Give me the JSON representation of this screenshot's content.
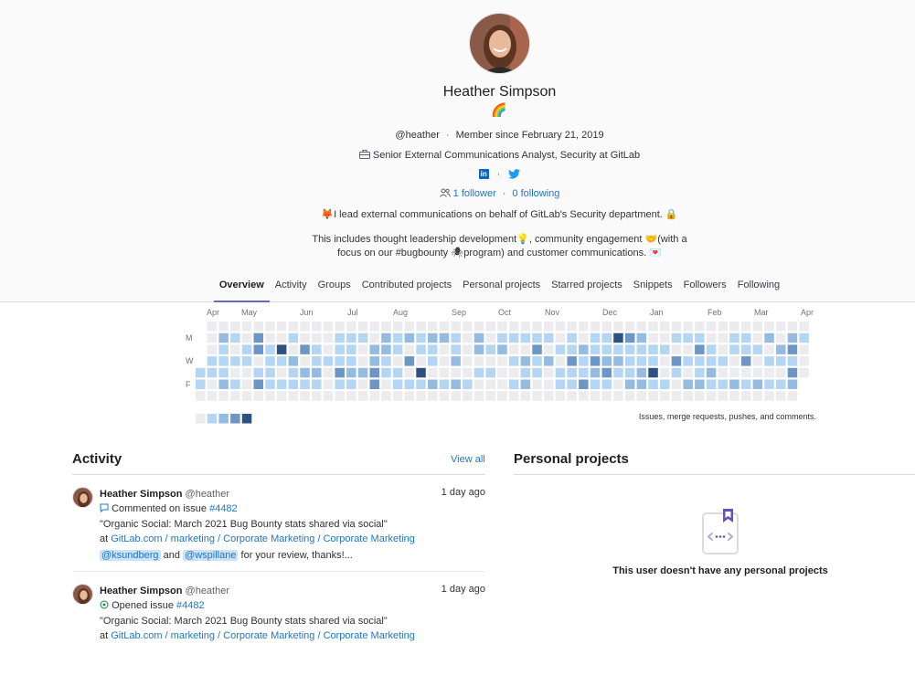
{
  "profile": {
    "name": "Heather Simpson",
    "status_emoji": "🌈",
    "username": "@heather",
    "member_since": "Member since February 21, 2019",
    "job_title": "Senior External Communications Analyst, Security at GitLab",
    "followers": "1 follower",
    "following": "0 following",
    "bio_line1_emoji": "🦊",
    "bio_line1": "I lead external communications on behalf of GitLab's Security department.",
    "bio_line1_end_emoji": "🔒",
    "bio_line2_a": "This includes thought leadership development",
    "bio_line2_emoji_a": "💡",
    "bio_line2_b": ", community engagement",
    "bio_line2_emoji_b": "🤝",
    "bio_line2_c": "(with a",
    "bio_line3_a": "focus on our #bugbounty",
    "bio_line3_emoji": "🕷",
    "bio_line3_b": "program) and customer communications.",
    "bio_line3_end_emoji": "💌"
  },
  "tabs": [
    "Overview",
    "Activity",
    "Groups",
    "Contributed projects",
    "Personal projects",
    "Starred projects",
    "Snippets",
    "Followers",
    "Following"
  ],
  "calendar": {
    "months": [
      "Apr",
      "May",
      "Jun",
      "Jul",
      "Aug",
      "Sep",
      "Oct",
      "Nov",
      "Dec",
      "Jan",
      "Feb",
      "Mar",
      "Apr"
    ],
    "days": [
      "M",
      "W",
      "F"
    ],
    "note": "Issues, merge requests, pushes, and comments.",
    "colors": [
      "#ececef",
      "#b5d6f3",
      "#95bce0",
      "#6e96c5",
      "#2d5181"
    ]
  },
  "activity": {
    "title": "Activity",
    "view_all": "View all",
    "events": [
      {
        "author": "Heather Simpson",
        "handle": "@heather",
        "when": "1 day ago",
        "action": "Commented on issue",
        "issue": "#4482",
        "quote": "\"Organic Social: March 2021 Bug Bounty stats shared via social\"",
        "at": "at",
        "project_path": "GitLab.com / marketing / Corporate Marketing / Corporate Marketing",
        "mention1": "@ksundberg",
        "and": "and",
        "mention2": "@wspillane",
        "comment_tail": "for your review, thanks!..."
      },
      {
        "author": "Heather Simpson",
        "handle": "@heather",
        "when": "1 day ago",
        "action": "Opened issue",
        "issue": "#4482",
        "quote": "\"Organic Social: March 2021 Bug Bounty stats shared via social\"",
        "at": "at",
        "project_path": "GitLab.com / marketing / Corporate Marketing / Corporate Marketing"
      }
    ]
  },
  "personal_projects": {
    "title": "Personal projects",
    "empty_text": "This user doesn't have any personal projects"
  }
}
